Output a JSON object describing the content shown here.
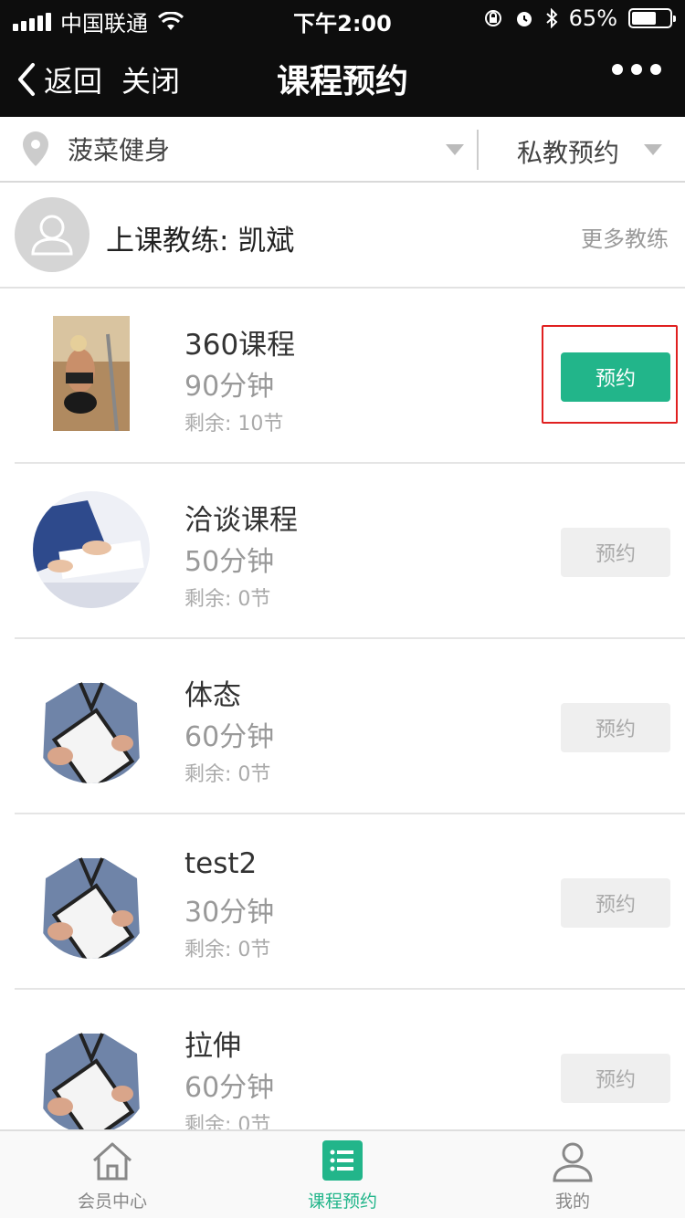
{
  "status_bar": {
    "carrier": "中国联通",
    "time": "下午2:00",
    "battery": "65%",
    "battery_level": 0.65
  },
  "nav": {
    "back_label": "返回",
    "close_label": "关闭",
    "title": "课程预约"
  },
  "filter": {
    "location": "菠菜健身",
    "booking_type": "私教预约"
  },
  "coach": {
    "label": "上课教练: 凯斌",
    "more_label": "更多教练"
  },
  "courses": [
    {
      "name": "360课程",
      "duration": "90分钟",
      "remaining": "剩余: 10节",
      "button": "预约",
      "active": true,
      "image": "fitness-woman-photo"
    },
    {
      "name": "洽谈课程",
      "duration": "50分钟",
      "remaining": "剩余: 0节",
      "button": "预约",
      "active": false,
      "image": "business-meeting-photo"
    },
    {
      "name": "体态",
      "duration": "60分钟",
      "remaining": "剩余: 0节",
      "button": "预约",
      "active": false,
      "image": "trainer-clipboard-photo"
    },
    {
      "name": "test2",
      "duration": "30分钟",
      "remaining": "剩余: 0节",
      "button": "预约",
      "active": false,
      "image": "trainer-clipboard-photo"
    },
    {
      "name": "拉伸",
      "duration": "60分钟",
      "remaining": "剩余: 0节",
      "button": "预约",
      "active": false,
      "image": "trainer-clipboard-photo"
    }
  ],
  "tabs": [
    {
      "label": "会员中心",
      "icon": "home-icon",
      "active": false
    },
    {
      "label": "课程预约",
      "icon": "list-icon",
      "active": true
    },
    {
      "label": "我的",
      "icon": "user-icon",
      "active": false
    }
  ],
  "colors": {
    "accent": "#22b58a",
    "header_bg": "#0d0d0d",
    "highlight_box": "#e02020"
  }
}
